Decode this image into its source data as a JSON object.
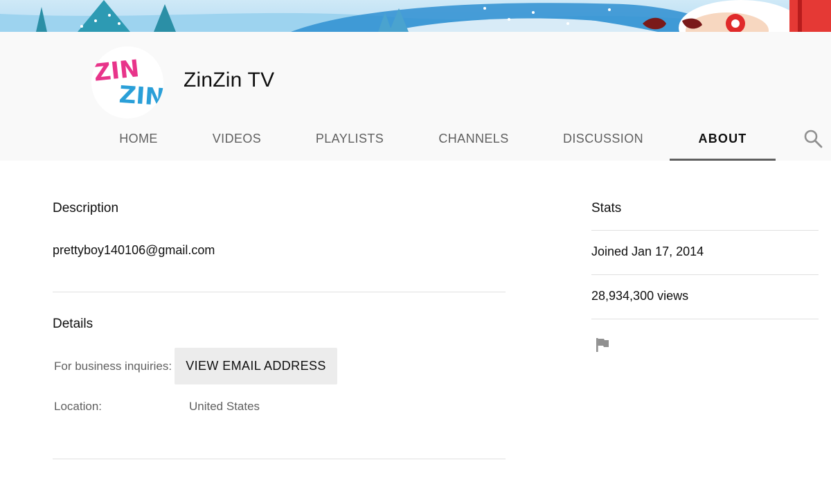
{
  "channel": {
    "name": "ZinZin TV",
    "logo_text": [
      "ZIN",
      "ZIN"
    ]
  },
  "tabs": [
    {
      "label": "HOME",
      "active": false
    },
    {
      "label": "VIDEOS",
      "active": false
    },
    {
      "label": "PLAYLISTS",
      "active": false
    },
    {
      "label": "CHANNELS",
      "active": false
    },
    {
      "label": "DISCUSSION",
      "active": false
    },
    {
      "label": "ABOUT",
      "active": true
    }
  ],
  "search": {
    "icon": "search-icon"
  },
  "description": {
    "title": "Description",
    "text": "prettyboy140106@gmail.com"
  },
  "details": {
    "title": "Details",
    "business_label": "For business inquiries:",
    "email_button": "VIEW EMAIL ADDRESS",
    "location_label": "Location:",
    "location_value": "United States"
  },
  "stats": {
    "title": "Stats",
    "joined": "Joined Jan 17, 2014",
    "views": "28,934,300 views",
    "report_icon": "flag-icon"
  },
  "colors": {
    "logo_pink": "#e8348a",
    "logo_blue": "#2a9fd8",
    "header_bg": "#f9f9f9",
    "button_bg": "#ececec",
    "tab_underline": "#606060"
  }
}
